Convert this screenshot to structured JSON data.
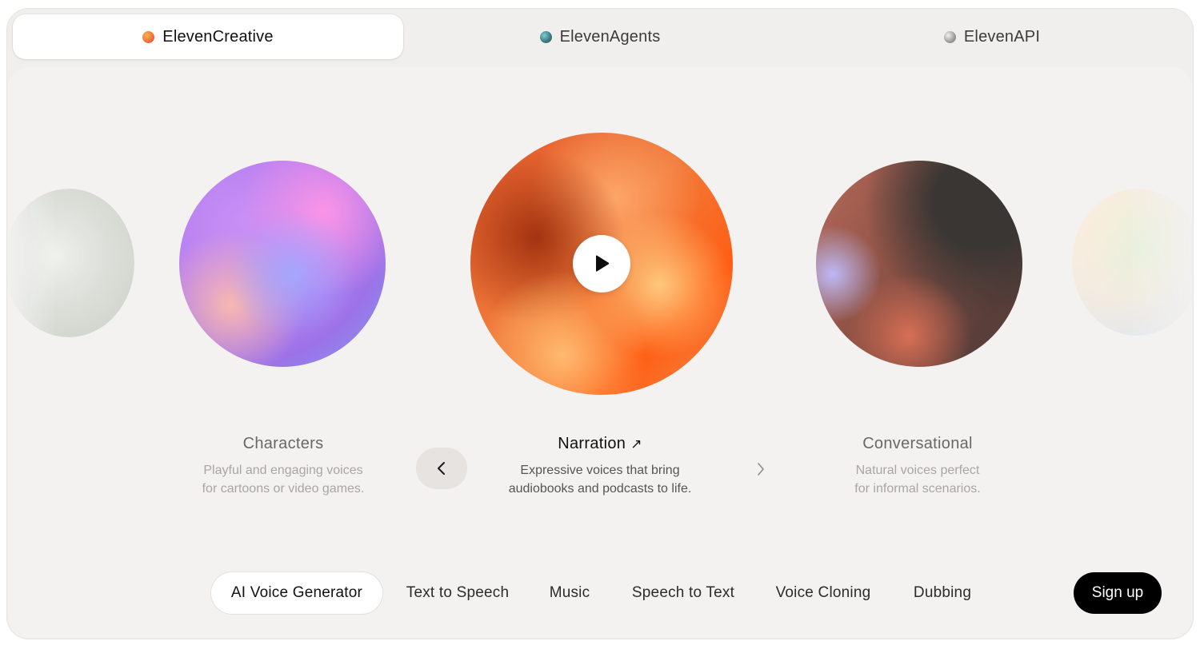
{
  "top_tabs": [
    {
      "label": "ElevenCreative",
      "active": true,
      "dot_color": "#e8633a"
    },
    {
      "label": "ElevenAgents",
      "active": false,
      "dot_color": "#3e7b8c"
    },
    {
      "label": "ElevenAPI",
      "active": false,
      "dot_color": "#9a9a9a"
    }
  ],
  "carousel": {
    "items": [
      {
        "title": "Characters",
        "description_line1": "Playful and engaging voices",
        "description_line2": "for cartoons or video games."
      },
      {
        "title": "Narration",
        "description_line1": "Expressive voices that bring",
        "description_line2": "audiobooks and podcasts to life.",
        "active": true
      },
      {
        "title": "Conversational",
        "description_line1": "Natural voices perfect",
        "description_line2": "for informal scenarios."
      }
    ],
    "active_link_icon": "arrow-up-right-icon",
    "play_icon": "play-icon",
    "prev_icon": "chevron-left-icon",
    "next_icon": "chevron-right-icon"
  },
  "bottom_nav": {
    "items": [
      {
        "label": "AI Voice Generator",
        "active": true
      },
      {
        "label": "Text to Speech"
      },
      {
        "label": "Music"
      },
      {
        "label": "Speech to Text"
      },
      {
        "label": "Voice Cloning"
      },
      {
        "label": "Dubbing"
      }
    ],
    "signup_label": "Sign up"
  }
}
